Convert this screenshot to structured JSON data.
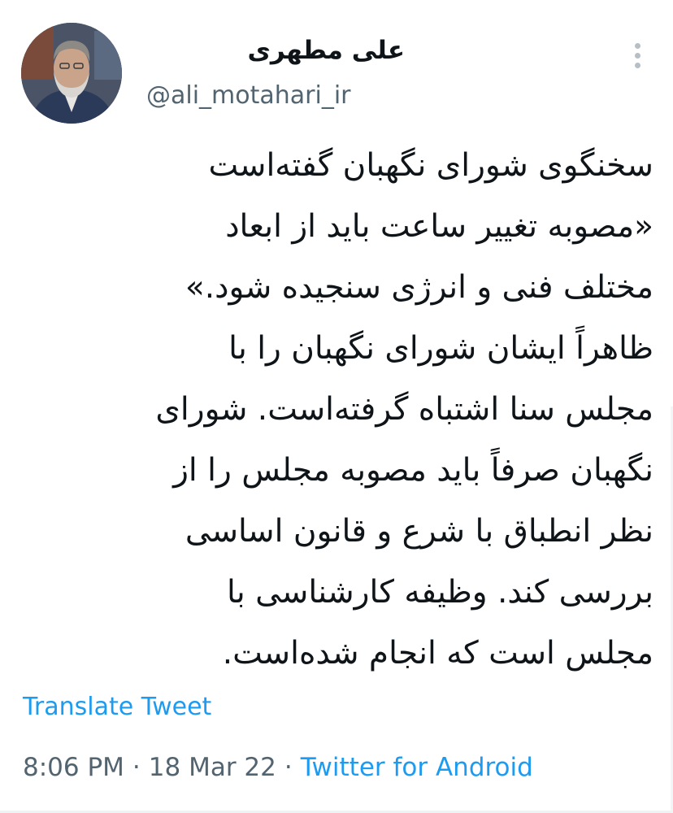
{
  "author": {
    "display_name": "علی مطهری",
    "handle": "@ali_motahari_ir"
  },
  "icons": {
    "more": "more-vertical-icon",
    "avatar": "profile-photo"
  },
  "tweet": {
    "lines": [
      "سخنگوی شورای نگهبان گفته‌است",
      "«مصوبه تغییر ساعت باید از ابعاد",
      "مختلف فنی و انرژی سنجیده شود.»",
      "ظاهراً ایشان شورای نگهبان را با",
      "مجلس سنا اشتباه گرفته‌است. شورای",
      "نگهبان صرفاً باید مصوبه مجلس را از",
      "نظر انطباق با شرع و قانون اساسی",
      "بررسی کند. وظیفه کارشناسی با",
      "مجلس است که انجام شده‌است."
    ],
    "translate_label": "Translate Tweet",
    "time": "8:06 PM",
    "date": "18 Mar 22",
    "separator": "·",
    "source": "Twitter for Android"
  },
  "colors": {
    "link": "#1d9bf0",
    "text": "#0f1419",
    "secondary": "#536471"
  }
}
